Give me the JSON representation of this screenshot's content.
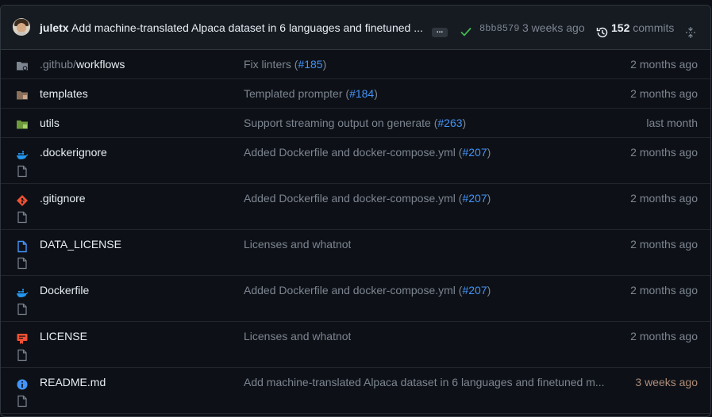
{
  "commit": {
    "author": "juletx",
    "message": "Add machine-translated Alpaca dataset in 6 languages and finetuned ...",
    "ellipsis_label": "...",
    "sha": "8bb8579",
    "age": "3 weeks ago",
    "commit_count": "152",
    "commits_label": "commits"
  },
  "files": [
    {
      "name_prefix": ".github/",
      "name": "workflows",
      "type": "folder",
      "message": "Fix linters (",
      "pr": "#185",
      "message_end": ")",
      "age": "2 months ago"
    },
    {
      "name_prefix": "",
      "name": "templates",
      "type": "folder",
      "message": "Templated prompter (",
      "pr": "#184",
      "message_end": ")",
      "age": "2 months ago"
    },
    {
      "name_prefix": "",
      "name": "utils",
      "type": "folder",
      "message": "Support streaming output on generate (",
      "pr": "#263",
      "message_end": ")",
      "age": "last month"
    },
    {
      "name_prefix": "",
      "name": ".dockerignore",
      "type": "file",
      "message": "Added Dockerfile and docker-compose.yml (",
      "pr": "#207",
      "message_end": ")",
      "age": "2 months ago"
    },
    {
      "name_prefix": "",
      "name": ".gitignore",
      "type": "file",
      "message": "Added Dockerfile and docker-compose.yml (",
      "pr": "#207",
      "message_end": ")",
      "age": "2 months ago"
    },
    {
      "name_prefix": "",
      "name": "DATA_LICENSE",
      "type": "file",
      "message": "Licenses and whatnot",
      "pr": "",
      "message_end": "",
      "age": "2 months ago"
    },
    {
      "name_prefix": "",
      "name": "Dockerfile",
      "type": "file",
      "message": "Added Dockerfile and docker-compose.yml (",
      "pr": "#207",
      "message_end": ")",
      "age": "2 months ago"
    },
    {
      "name_prefix": "",
      "name": "LICENSE",
      "type": "file",
      "message": "Licenses and whatnot",
      "pr": "",
      "message_end": "",
      "age": "2 months ago"
    },
    {
      "name_prefix": "",
      "name": "README.md",
      "type": "file",
      "message": "Add machine-translated Alpaca dataset in 6 languages and finetuned m...",
      "pr": "",
      "message_end": "",
      "age": "3 weeks ago"
    }
  ],
  "icons": {
    "check_color": "#3fb950",
    "folder_color": "#7d8590",
    "link_color": "#4493f8"
  }
}
